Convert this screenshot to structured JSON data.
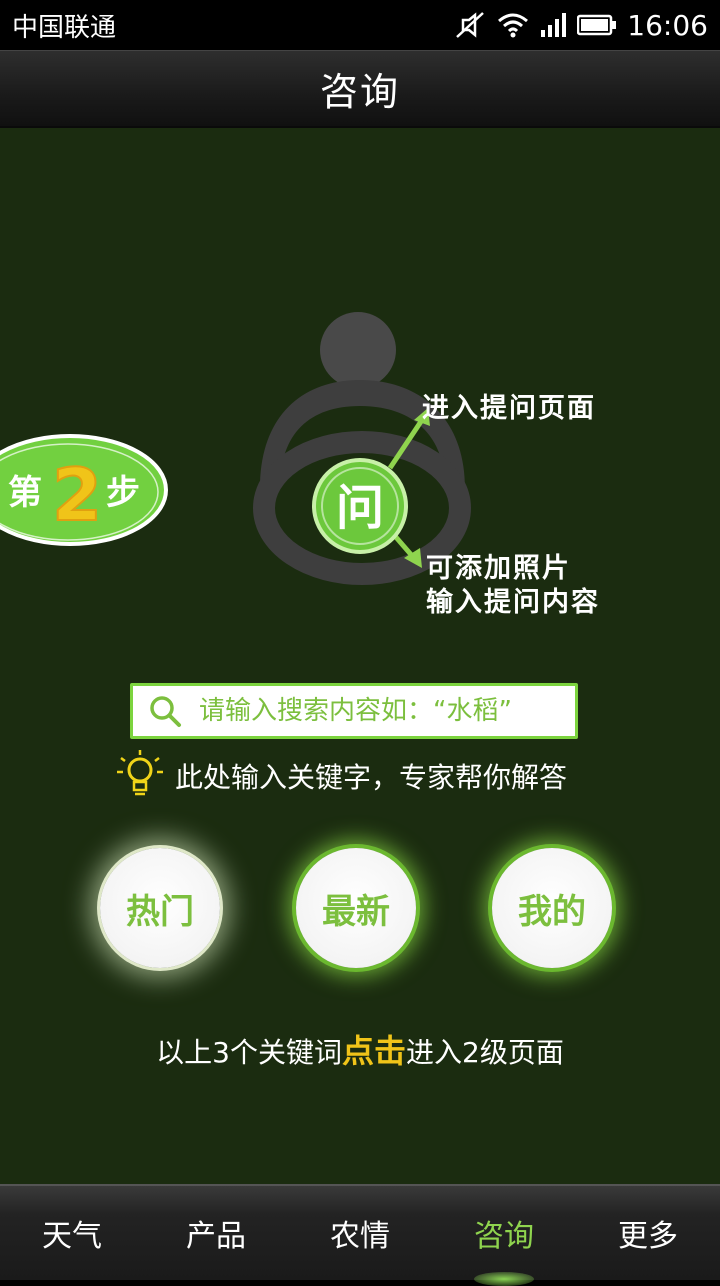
{
  "status_bar": {
    "carrier": "中国联通",
    "time": "16:06"
  },
  "header": {
    "title": "咨询"
  },
  "illustration": {
    "step_prefix": "第",
    "step_number": "2",
    "step_suffix": "步",
    "center_char": "问",
    "callout_top": "进入提问页面",
    "callout_bottom_line1": "可添加照片",
    "callout_bottom_line2": "输入提问内容"
  },
  "search": {
    "placeholder": "请输入搜索内容如：“水稻”"
  },
  "hint": {
    "text": "此处输入关键字，专家帮你解答"
  },
  "keywords": [
    {
      "label": "热门"
    },
    {
      "label": "最新"
    },
    {
      "label": "我的"
    }
  ],
  "footer_note": {
    "before": "以上3个关键词",
    "highlight": "点击",
    "after": "进入2级页面"
  },
  "bottom_nav": {
    "items": [
      {
        "label": "天气"
      },
      {
        "label": "产品"
      },
      {
        "label": "农情"
      },
      {
        "label": "咨询"
      },
      {
        "label": "更多"
      }
    ],
    "active_index": 3
  },
  "colors": {
    "accent_green": "#7cd43e",
    "background": "#1b2c10",
    "highlight_yellow": "#f0c419"
  }
}
